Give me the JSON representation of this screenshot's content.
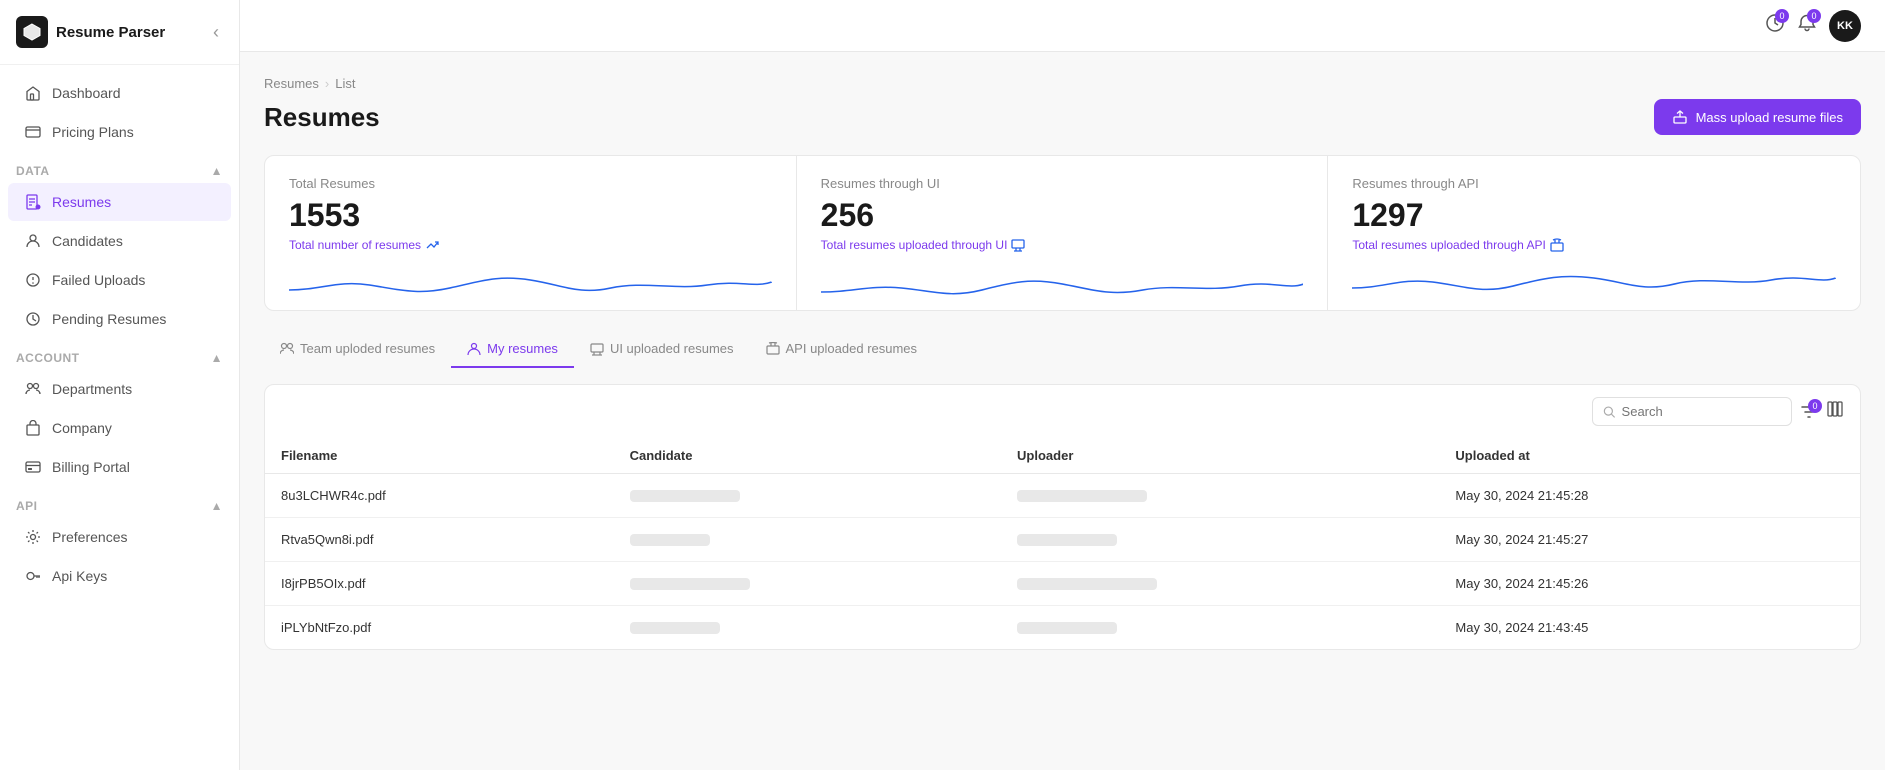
{
  "app": {
    "name": "Resume Parser",
    "logo_char": "⬡"
  },
  "topbar": {
    "history_badge": "0",
    "bell_badge": "0",
    "avatar_initials": "KK"
  },
  "sidebar": {
    "top_nav": [
      {
        "id": "dashboard",
        "label": "Dashboard",
        "icon": "🏠"
      },
      {
        "id": "pricing",
        "label": "Pricing Plans",
        "icon": "⊞"
      }
    ],
    "sections": [
      {
        "id": "data",
        "label": "Data",
        "items": [
          {
            "id": "resumes",
            "label": "Resumes",
            "icon": "📄",
            "active": true
          },
          {
            "id": "candidates",
            "label": "Candidates",
            "icon": "👤"
          },
          {
            "id": "failed-uploads",
            "label": "Failed Uploads",
            "icon": "⏱"
          },
          {
            "id": "pending-resumes",
            "label": "Pending Resumes",
            "icon": "⏱"
          }
        ]
      },
      {
        "id": "account",
        "label": "Account",
        "items": [
          {
            "id": "departments",
            "label": "Departments",
            "icon": "👥"
          },
          {
            "id": "company",
            "label": "Company",
            "icon": "🏢"
          },
          {
            "id": "billing",
            "label": "Billing Portal",
            "icon": "💳"
          }
        ]
      },
      {
        "id": "api",
        "label": "API",
        "items": [
          {
            "id": "preferences",
            "label": "Preferences",
            "icon": "⚙"
          },
          {
            "id": "api-keys",
            "label": "Api Keys",
            "icon": "🔑"
          }
        ]
      }
    ]
  },
  "breadcrumb": {
    "items": [
      "Resumes",
      "List"
    ]
  },
  "page": {
    "title": "Resumes",
    "mass_upload_label": "Mass upload resume files"
  },
  "stats": [
    {
      "label": "Total Resumes",
      "value": "1553",
      "sub": "Total number of resumes",
      "icon": "↗",
      "color": "#2563eb"
    },
    {
      "label": "Resumes through UI",
      "value": "256",
      "sub": "Total resumes uploaded through UI",
      "icon": "🖥",
      "color": "#2563eb"
    },
    {
      "label": "Resumes through API",
      "value": "1297",
      "sub": "Total resumes uploaded through API",
      "icon": "↗",
      "color": "#2563eb"
    }
  ],
  "tabs": [
    {
      "id": "team",
      "label": "Team uploded resumes",
      "icon": "👥",
      "active": false
    },
    {
      "id": "my",
      "label": "My resumes",
      "icon": "👤",
      "active": true
    },
    {
      "id": "ui",
      "label": "UI uploaded resumes",
      "icon": "🖥",
      "active": false
    },
    {
      "id": "api",
      "label": "API uploaded resumes",
      "icon": "↗",
      "active": false
    }
  ],
  "table": {
    "search_placeholder": "Search",
    "filter_badge": "0",
    "columns": [
      "Filename",
      "Candidate",
      "Uploader",
      "Uploaded at"
    ],
    "rows": [
      {
        "filename": "8u3LCHWR4c.pdf",
        "uploaded_at": "May 30, 2024 21:45:28"
      },
      {
        "filename": "Rtva5Qwn8i.pdf",
        "uploaded_at": "May 30, 2024 21:45:27"
      },
      {
        "filename": "I8jrPB5OIx.pdf",
        "uploaded_at": "May 30, 2024 21:45:26"
      },
      {
        "filename": "iPLYbNtFzo.pdf",
        "uploaded_at": "May 30, 2024 21:43:45"
      }
    ]
  }
}
